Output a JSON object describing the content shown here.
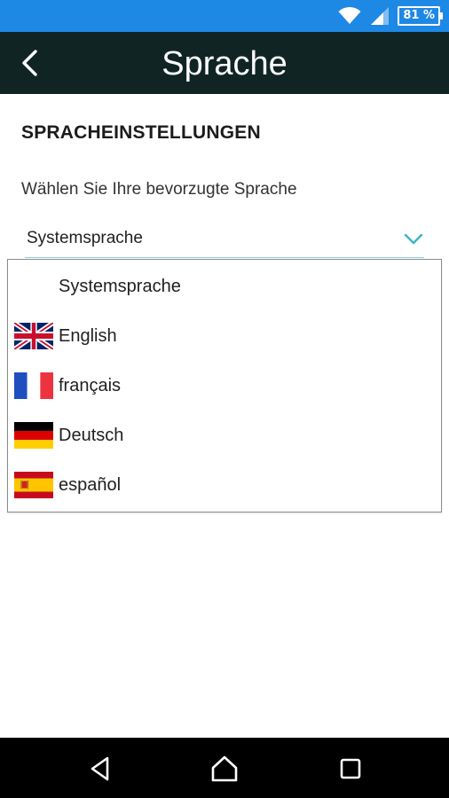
{
  "status_bar": {
    "battery": "81 %",
    "icons": [
      "wifi-icon",
      "signal-icon",
      "battery-icon"
    ],
    "color": "#1e88e5"
  },
  "app_bar": {
    "title": "Sprache",
    "back_icon": "back-arrow-icon",
    "color": "#102424"
  },
  "content": {
    "section_title": "SPRACHEINSTELLUNGEN",
    "field_label": "Wählen Sie Ihre bevorzugte Sprache",
    "selected_value": "Systemsprache",
    "chevron_icon": "chevron-down-icon",
    "accent_color": "#3bb4c4"
  },
  "dropdown": {
    "options": [
      {
        "label": "Systemsprache",
        "flag": "none"
      },
      {
        "label": "English",
        "flag": "uk-flag-icon"
      },
      {
        "label": "français",
        "flag": "france-flag-icon"
      },
      {
        "label": "Deutsch",
        "flag": "germany-flag-icon"
      },
      {
        "label": "español",
        "flag": "spain-flag-icon"
      }
    ]
  },
  "nav_bar": {
    "icons": [
      "back-triangle-icon",
      "home-icon",
      "recents-icon"
    ]
  }
}
